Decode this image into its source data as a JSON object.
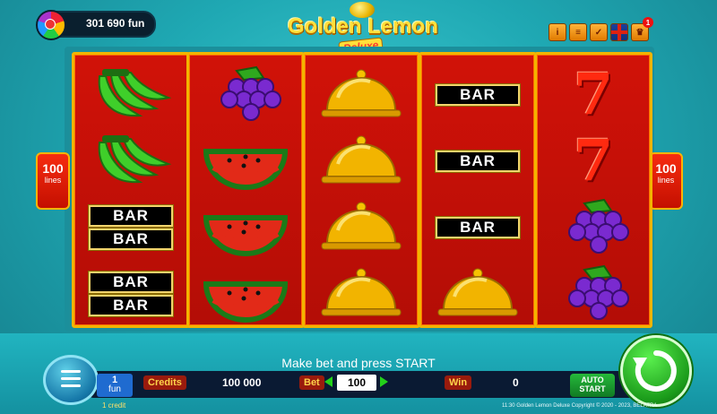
{
  "header": {
    "balance": "301 690 fun",
    "logo_title": "Golden Lemon",
    "logo_subtitle": "Deluxe",
    "notification_count": "1",
    "tools": [
      "info-icon",
      "paytable-icon",
      "settings-icon",
      "language-flag-icon",
      "trophy-icon"
    ]
  },
  "lines": {
    "value": "100",
    "label": "lines"
  },
  "reels": [
    [
      "banana",
      "banana",
      "bar-double",
      "bar-double"
    ],
    [
      "grapes",
      "watermelon",
      "watermelon",
      "watermelon"
    ],
    [
      "cloche",
      "cloche",
      "cloche",
      "cloche"
    ],
    [
      "bar",
      "bar",
      "bar",
      "cloche"
    ],
    [
      "seven",
      "seven",
      "grapes",
      "grapes"
    ]
  ],
  "symbols": {
    "bar_text": "BAR",
    "seven_text": "7"
  },
  "status_message": "Make bet and press START",
  "panel": {
    "fun_value": "1",
    "fun_unit": "fun",
    "credits_label": "Credits",
    "credits_value": "100 000",
    "bet_label": "Bet",
    "bet_value": "100",
    "win_label": "Win",
    "win_value": "0",
    "auto_start_line1": "AUTO",
    "auto_start_line2": "START",
    "credits_small": "1 credit"
  },
  "footer": {
    "copyright": "11:30  Golden Lemon Deluxe Copyright © 2020 - 2023, BELATRA"
  },
  "colors": {
    "background": "#1fa8b3",
    "reel": "#c8120a",
    "reel_border": "#f2b400",
    "panel": "#0a1a33",
    "spin_button": "#1a9a1a"
  }
}
